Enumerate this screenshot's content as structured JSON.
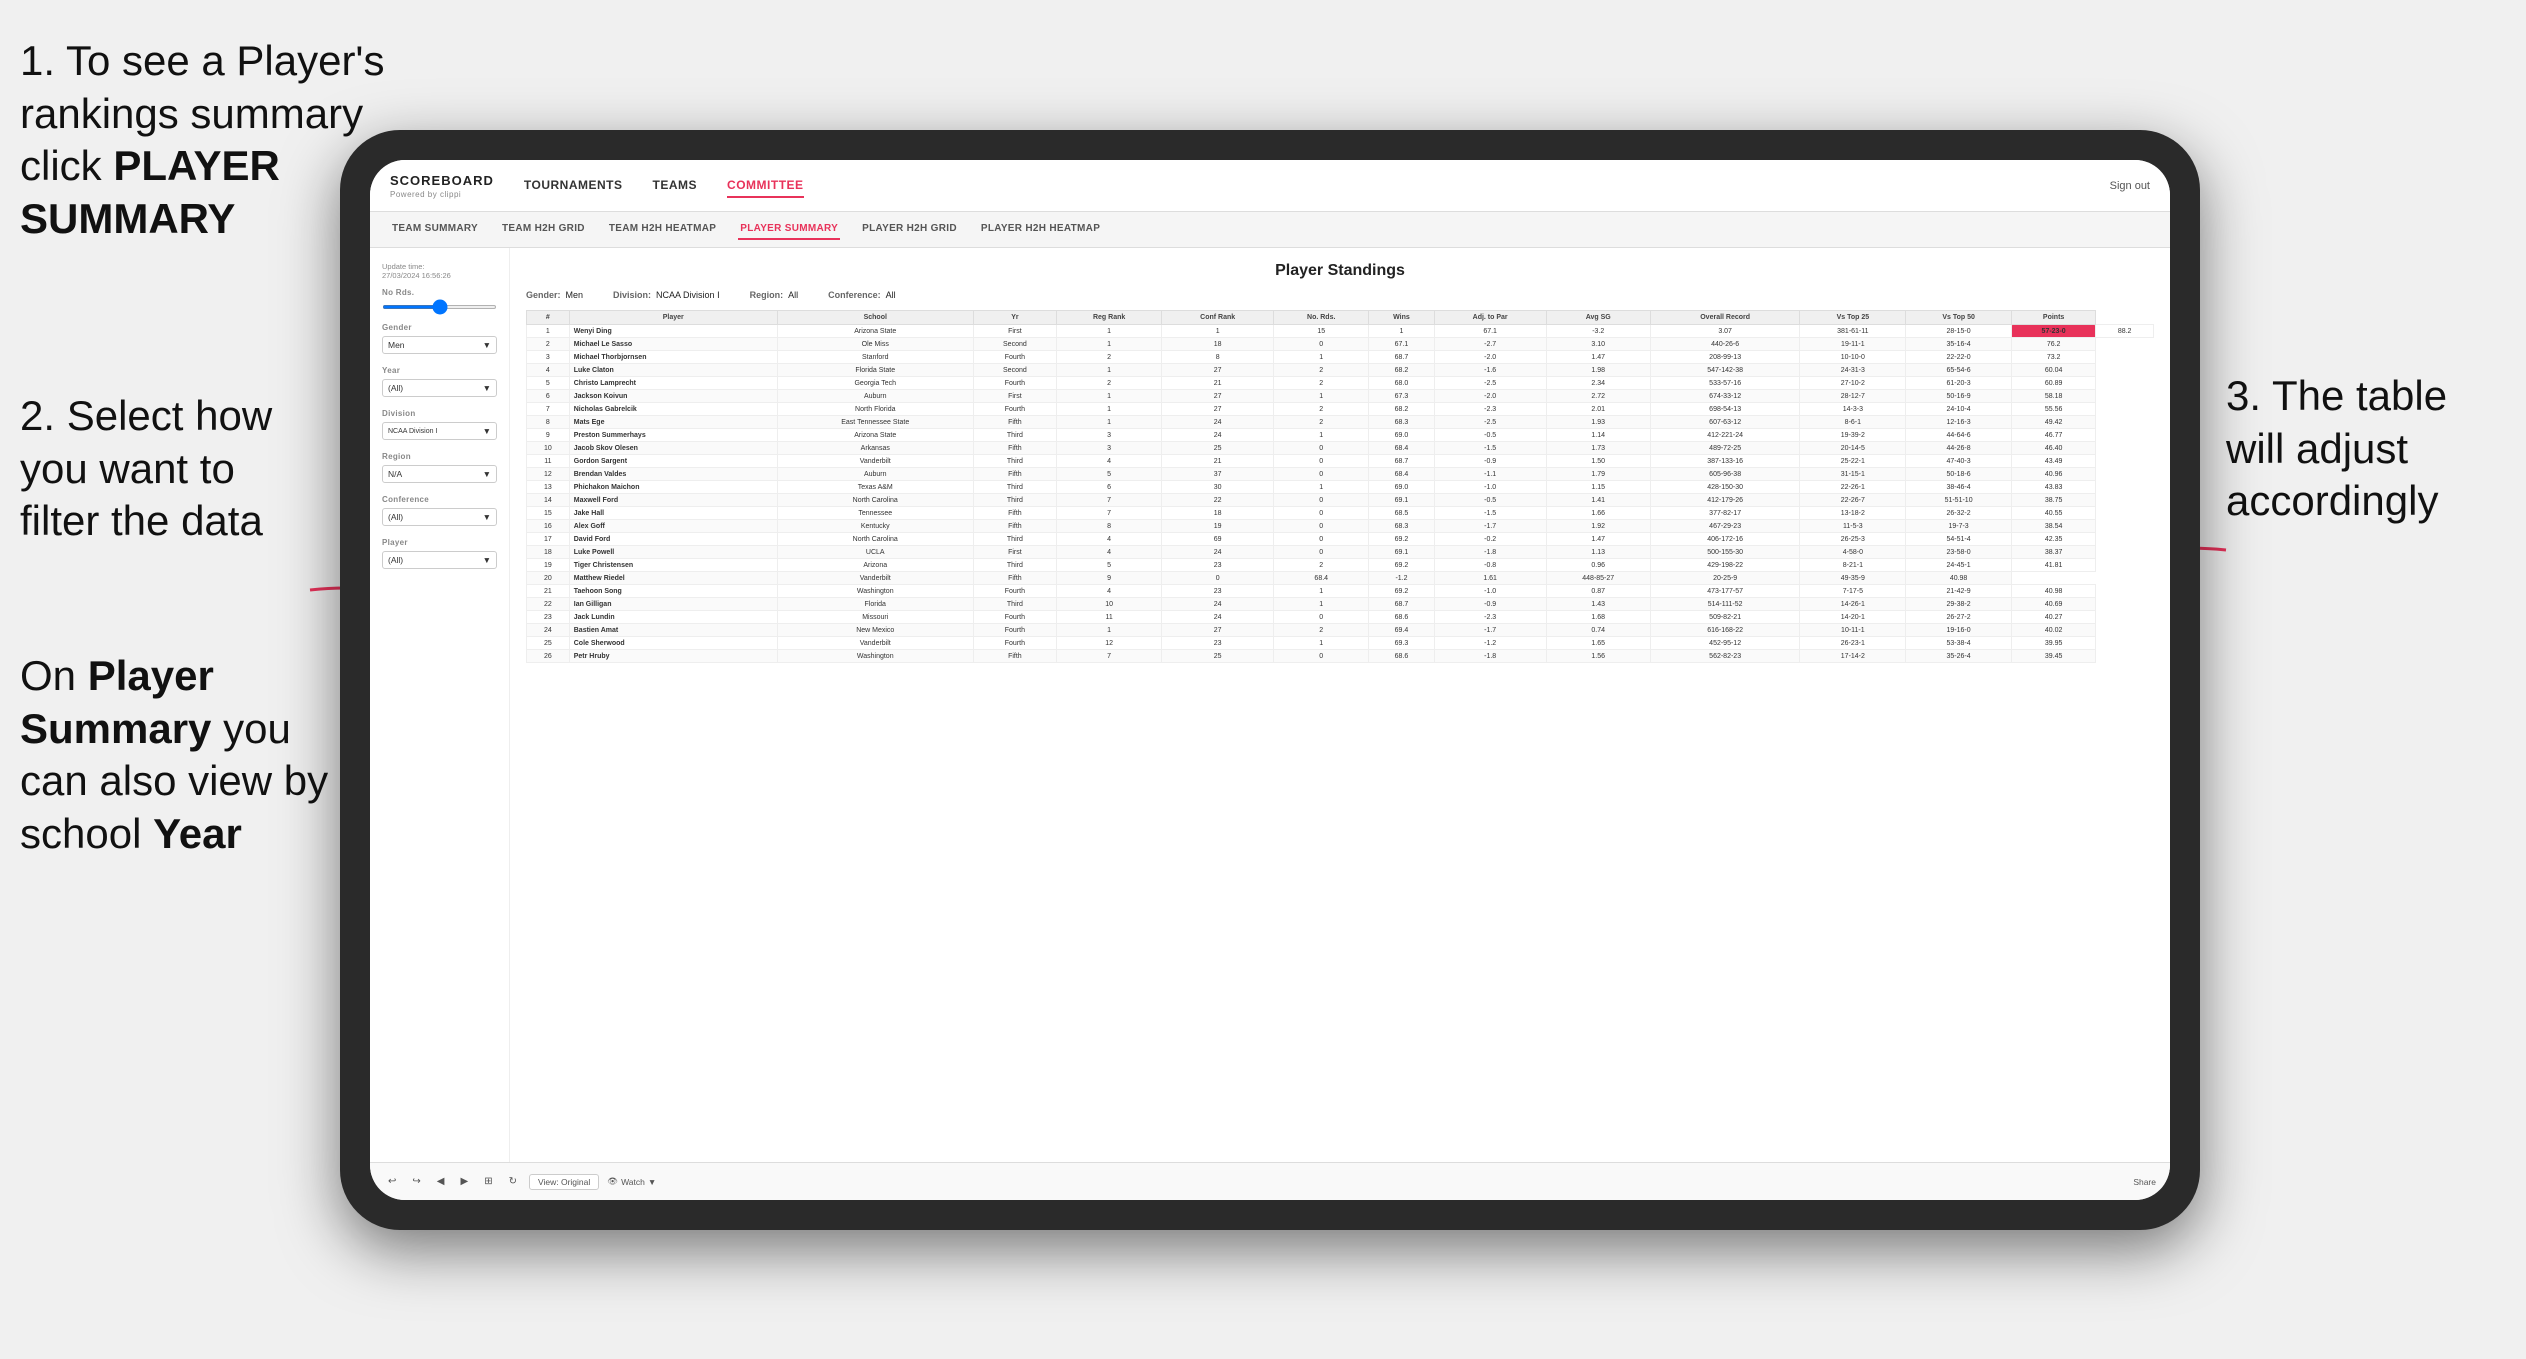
{
  "instructions": {
    "step1": "1. To see a Player's rankings summary click ",
    "step1_bold": "PLAYER SUMMARY",
    "step2_title": "2. Select how you want to filter the data",
    "step3_right_title": "3. The table will adjust accordingly",
    "step4_title": "On ",
    "step4_bold1": "Player Summary",
    "step4_mid": " you can also view by school ",
    "step4_bold2": "Year"
  },
  "nav": {
    "logo": "SCOREBOARD",
    "logo_sub": "Powered by clippi",
    "links": [
      "TOURNAMENTS",
      "TEAMS",
      "COMMITTEE"
    ],
    "sign_out": "Sign out"
  },
  "sub_nav": {
    "links": [
      "TEAM SUMMARY",
      "TEAM H2H GRID",
      "TEAM H2H HEATMAP",
      "PLAYER SUMMARY",
      "PLAYER H2H GRID",
      "PLAYER H2H HEATMAP"
    ],
    "active": "PLAYER SUMMARY"
  },
  "sidebar": {
    "update_label": "Update time:",
    "update_date": "27/03/2024 16:56:26",
    "no_rds_label": "No Rds.",
    "gender_label": "Gender",
    "gender_value": "Men",
    "year_label": "Year",
    "year_value": "(All)",
    "division_label": "Division",
    "division_value": "NCAA Division I",
    "region_label": "Region",
    "region_value": "N/A",
    "conference_label": "Conference",
    "conference_value": "(All)",
    "player_label": "Player",
    "player_value": "(All)"
  },
  "table": {
    "title": "Player Standings",
    "filters": {
      "gender_label": "Gender:",
      "gender_value": "Men",
      "division_label": "Division:",
      "division_value": "NCAA Division I",
      "region_label": "Region:",
      "region_value": "All",
      "conference_label": "Conference:",
      "conference_value": "All"
    },
    "columns": [
      "#",
      "Player",
      "School",
      "Yr",
      "Reg Rank",
      "Conf Rank",
      "No. Rds.",
      "Wins",
      "Adj. to Par",
      "Avg SG",
      "Overall Record",
      "Vs Top 25",
      "Vs Top 50",
      "Points"
    ],
    "rows": [
      [
        "1",
        "Wenyi Ding",
        "Arizona State",
        "First",
        "1",
        "1",
        "15",
        "1",
        "67.1",
        "-3.2",
        "3.07",
        "381-61-11",
        "28-15-0",
        "57-23-0",
        "88.2"
      ],
      [
        "2",
        "Michael Le Sasso",
        "Ole Miss",
        "Second",
        "1",
        "18",
        "0",
        "67.1",
        "-2.7",
        "3.10",
        "440-26-6",
        "19-11-1",
        "35-16-4",
        "76.2"
      ],
      [
        "3",
        "Michael Thorbjornsen",
        "Stanford",
        "Fourth",
        "2",
        "8",
        "1",
        "68.7",
        "-2.0",
        "1.47",
        "208-99-13",
        "10-10-0",
        "22-22-0",
        "73.2"
      ],
      [
        "4",
        "Luke Claton",
        "Florida State",
        "Second",
        "1",
        "27",
        "2",
        "68.2",
        "-1.6",
        "1.98",
        "547-142-38",
        "24-31-3",
        "65-54-6",
        "60.04"
      ],
      [
        "5",
        "Christo Lamprecht",
        "Georgia Tech",
        "Fourth",
        "2",
        "21",
        "2",
        "68.0",
        "-2.5",
        "2.34",
        "533-57-16",
        "27-10-2",
        "61-20-3",
        "60.89"
      ],
      [
        "6",
        "Jackson Koivun",
        "Auburn",
        "First",
        "1",
        "27",
        "1",
        "67.3",
        "-2.0",
        "2.72",
        "674-33-12",
        "28-12-7",
        "50-16-9",
        "58.18"
      ],
      [
        "7",
        "Nicholas Gabrelcik",
        "North Florida",
        "Fourth",
        "1",
        "27",
        "2",
        "68.2",
        "-2.3",
        "2.01",
        "698-54-13",
        "14-3-3",
        "24-10-4",
        "55.56"
      ],
      [
        "8",
        "Mats Ege",
        "East Tennessee State",
        "Fifth",
        "1",
        "24",
        "2",
        "68.3",
        "-2.5",
        "1.93",
        "607-63-12",
        "8-6-1",
        "12-16-3",
        "49.42"
      ],
      [
        "9",
        "Preston Summerhays",
        "Arizona State",
        "Third",
        "3",
        "24",
        "1",
        "69.0",
        "-0.5",
        "1.14",
        "412-221-24",
        "19-39-2",
        "44-64-6",
        "46.77"
      ],
      [
        "10",
        "Jacob Skov Olesen",
        "Arkansas",
        "Fifth",
        "3",
        "25",
        "0",
        "68.4",
        "-1.5",
        "1.73",
        "489-72-25",
        "20-14-5",
        "44-26-8",
        "46.40"
      ],
      [
        "11",
        "Gordon Sargent",
        "Vanderbilt",
        "Third",
        "4",
        "21",
        "0",
        "68.7",
        "-0.9",
        "1.50",
        "387-133-16",
        "25-22-1",
        "47-40-3",
        "43.49"
      ],
      [
        "12",
        "Brendan Valdes",
        "Auburn",
        "Fifth",
        "5",
        "37",
        "0",
        "68.4",
        "-1.1",
        "1.79",
        "605-96-38",
        "31-15-1",
        "50-18-6",
        "40.96"
      ],
      [
        "13",
        "Phichakon Maichon",
        "Texas A&M",
        "Third",
        "6",
        "30",
        "1",
        "69.0",
        "-1.0",
        "1.15",
        "428-150-30",
        "22-26-1",
        "38-46-4",
        "43.83"
      ],
      [
        "14",
        "Maxwell Ford",
        "North Carolina",
        "Third",
        "7",
        "22",
        "0",
        "69.1",
        "-0.5",
        "1.41",
        "412-179-26",
        "22-26-7",
        "51-51-10",
        "38.75"
      ],
      [
        "15",
        "Jake Hall",
        "Tennessee",
        "Fifth",
        "7",
        "18",
        "0",
        "68.5",
        "-1.5",
        "1.66",
        "377-82-17",
        "13-18-2",
        "26-32-2",
        "40.55"
      ],
      [
        "16",
        "Alex Goff",
        "Kentucky",
        "Fifth",
        "8",
        "19",
        "0",
        "68.3",
        "-1.7",
        "1.92",
        "467-29-23",
        "11-5-3",
        "19-7-3",
        "38.54"
      ],
      [
        "17",
        "David Ford",
        "North Carolina",
        "Third",
        "4",
        "69",
        "0",
        "69.2",
        "-0.2",
        "1.47",
        "406-172-16",
        "26-25-3",
        "54-51-4",
        "42.35"
      ],
      [
        "18",
        "Luke Powell",
        "UCLA",
        "First",
        "4",
        "24",
        "0",
        "69.1",
        "-1.8",
        "1.13",
        "500-155-30",
        "4-58-0",
        "23-58-0",
        "38.37"
      ],
      [
        "19",
        "Tiger Christensen",
        "Arizona",
        "Third",
        "5",
        "23",
        "2",
        "69.2",
        "-0.8",
        "0.96",
        "429-198-22",
        "8-21-1",
        "24-45-1",
        "41.81"
      ],
      [
        "20",
        "Matthew Riedel",
        "Vanderbilt",
        "Fifth",
        "9",
        "0",
        "68.4",
        "-1.2",
        "1.61",
        "448-85-27",
        "20-25-9",
        "49-35-9",
        "40.98"
      ],
      [
        "21",
        "Taehoon Song",
        "Washington",
        "Fourth",
        "4",
        "23",
        "1",
        "69.2",
        "-1.0",
        "0.87",
        "473-177-57",
        "7-17-5",
        "21-42-9",
        "40.98"
      ],
      [
        "22",
        "Ian Gilligan",
        "Florida",
        "Third",
        "10",
        "24",
        "1",
        "68.7",
        "-0.9",
        "1.43",
        "514-111-52",
        "14-26-1",
        "29-38-2",
        "40.69"
      ],
      [
        "23",
        "Jack Lundin",
        "Missouri",
        "Fourth",
        "11",
        "24",
        "0",
        "68.6",
        "-2.3",
        "1.68",
        "509-82-21",
        "14-20-1",
        "26-27-2",
        "40.27"
      ],
      [
        "24",
        "Bastien Amat",
        "New Mexico",
        "Fourth",
        "1",
        "27",
        "2",
        "69.4",
        "-1.7",
        "0.74",
        "616-168-22",
        "10-11-1",
        "19-16-0",
        "40.02"
      ],
      [
        "25",
        "Cole Sherwood",
        "Vanderbilt",
        "Fourth",
        "12",
        "23",
        "1",
        "69.3",
        "-1.2",
        "1.65",
        "452-95-12",
        "26-23-1",
        "53-38-4",
        "39.95"
      ],
      [
        "26",
        "Petr Hruby",
        "Washington",
        "Fifth",
        "7",
        "25",
        "0",
        "68.6",
        "-1.8",
        "1.56",
        "562-82-23",
        "17-14-2",
        "35-26-4",
        "39.45"
      ]
    ]
  },
  "toolbar": {
    "view_label": "View: Original",
    "watch_label": "Watch",
    "share_label": "Share"
  }
}
